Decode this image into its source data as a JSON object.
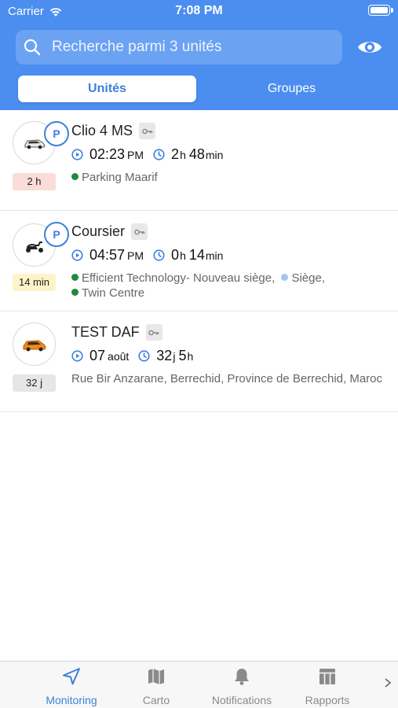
{
  "status_bar": {
    "carrier": "Carrier",
    "time": "7:08 PM"
  },
  "search": {
    "placeholder": "Recherche parmi 3 unités"
  },
  "segments": {
    "units": "Unités",
    "groups": "Groupes"
  },
  "units": [
    {
      "name": "Clio 4 MS",
      "parked_badge": "P",
      "age": "2 h",
      "time_main": "02:23",
      "time_suffix": "PM",
      "dur_a": "2",
      "dur_a_unit": "h",
      "dur_b": "48",
      "dur_b_unit": "min",
      "locations": [
        {
          "text": "Parking Maarif",
          "dot": "green"
        }
      ]
    },
    {
      "name": "Coursier",
      "parked_badge": "P",
      "age": "14 min",
      "time_main": "04:57",
      "time_suffix": "PM",
      "dur_a": "0",
      "dur_a_unit": "h",
      "dur_b": "14",
      "dur_b_unit": "min",
      "locations": [
        {
          "text": "Efficient Technology- Nouveau siège,",
          "dot": "green"
        },
        {
          "text": "Siège,",
          "dot": "blue"
        },
        {
          "text": "Twin Centre",
          "dot": "green"
        }
      ]
    },
    {
      "name": "TEST DAF",
      "age": "32 j",
      "time_main": "07",
      "time_suffix": "août",
      "dur_a": "32",
      "dur_a_unit": "j",
      "dur_b": "5",
      "dur_b_unit": "h",
      "address": "Rue Bir Anzarane, Berrechid, Province de Berrechid, Maroc"
    }
  ],
  "tabs": [
    {
      "label": "Monitoring",
      "icon": "navigation-arrow-icon",
      "active": true
    },
    {
      "label": "Carto",
      "icon": "map-icon"
    },
    {
      "label": "Notifications",
      "icon": "bell-icon"
    },
    {
      "label": "Rapports",
      "icon": "table-icon"
    }
  ],
  "colors": {
    "accent": "#4b8ef0",
    "active_tab": "#3f7fe0",
    "parked_dot": "#1e8a3c"
  }
}
